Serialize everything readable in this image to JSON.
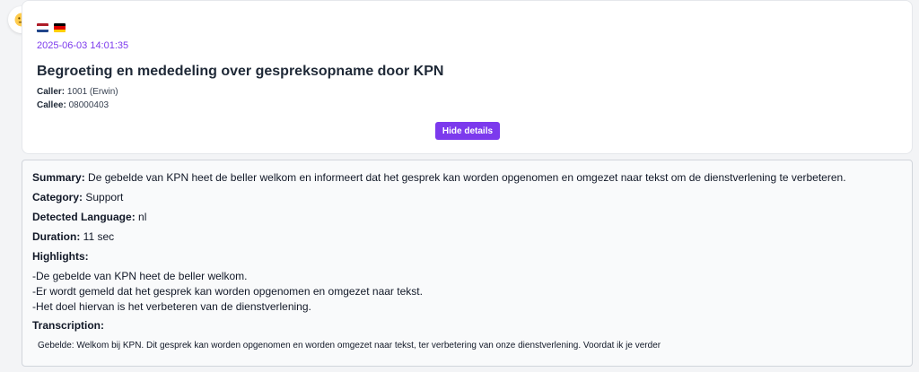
{
  "sentiment": {
    "icon": "neutral-face-icon"
  },
  "call": {
    "flags": [
      {
        "icon": "flag-netherlands-icon",
        "colors": [
          "#AE1C28",
          "#FFFFFF",
          "#21468B"
        ]
      },
      {
        "icon": "flag-germany-icon",
        "colors": [
          "#000000",
          "#DD0000",
          "#FFCE00"
        ]
      }
    ],
    "timestamp": "2025-06-03 14:01:35",
    "title": "Begroeting en mededeling over gespreksopname door KPN",
    "caller_label": "Caller:",
    "caller_value": "1001 (Erwin)",
    "callee_label": "Callee:",
    "callee_value": "08000403",
    "hide_details_label": "Hide details"
  },
  "details": {
    "summary_label": "Summary:",
    "summary_value": "De gebelde van KPN heet de beller welkom en informeert dat het gesprek kan worden opgenomen en omgezet naar tekst om de dienstverlening te verbeteren.",
    "category_label": "Category:",
    "category_value": "Support",
    "language_label": "Detected Language:",
    "language_value": "nl",
    "duration_label": "Duration:",
    "duration_value": "11 sec",
    "highlights_label": "Highlights:",
    "highlights": [
      "-De gebelde van KPN heet de beller welkom.",
      "-Er wordt gemeld dat het gesprek kan worden opgenomen en omgezet naar tekst.",
      "-Het doel hiervan is het verbeteren van de dienstverlening."
    ],
    "transcription_label": "Transcription:",
    "transcription_value": "Gebelde: Welkom bij KPN. Dit gesprek kan worden opgenomen en worden omgezet naar tekst, ter verbetering van onze dienstverlening. Voordat ik je verder"
  },
  "colors": {
    "accent": "#7c3aed",
    "card_bg": "#ffffff",
    "details_bg": "#f9fafb"
  }
}
